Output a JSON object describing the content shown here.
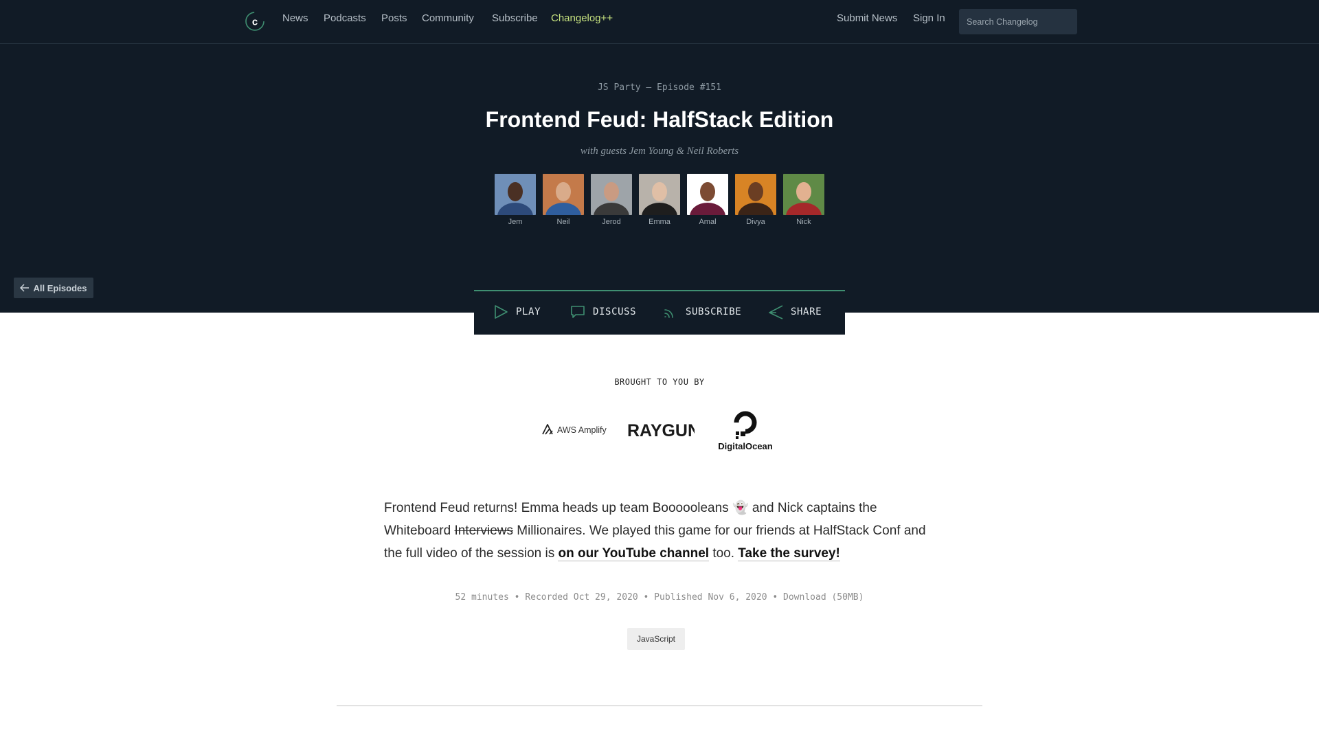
{
  "nav": {
    "links": [
      "News",
      "Podcasts",
      "Posts",
      "Community",
      "Subscribe",
      "Changelog++"
    ],
    "right_links": [
      "Submit News",
      "Sign In"
    ],
    "search_placeholder": "Search Changelog"
  },
  "episode": {
    "kicker": "JS Party – Episode #151",
    "title": "Frontend Feud: HalfStack Edition",
    "guests_line": "with guests Jem Young & Neil Roberts"
  },
  "people": [
    {
      "name": "Jem",
      "bg": "#6f8fb8",
      "skin": "#4a3024",
      "shirt": "#2d4a7a"
    },
    {
      "name": "Neil",
      "bg": "#c47a4a",
      "skin": "#d9ab8a",
      "shirt": "#2f5e9e"
    },
    {
      "name": "Jerod",
      "bg": "#9ea4a9",
      "skin": "#c99b82",
      "shirt": "#3a3a3a"
    },
    {
      "name": "Emma",
      "bg": "#b8b2aa",
      "skin": "#e0bfa6",
      "shirt": "#1e1e1e"
    },
    {
      "name": "Amal",
      "bg": "#ffffff",
      "skin": "#7c4b33",
      "shirt": "#6a1b3a"
    },
    {
      "name": "Divya",
      "bg": "#d88425",
      "skin": "#6b3e23",
      "shirt": "#3b2417"
    },
    {
      "name": "Nick",
      "bg": "#5f8a46",
      "skin": "#e2b190",
      "shirt": "#a5282a"
    }
  ],
  "back_button": "All Episodes",
  "actions": [
    "PLAY",
    "DISCUSS",
    "SUBSCRIBE",
    "SHARE"
  ],
  "brought_label": "BROUGHT TO YOU BY",
  "sponsors": [
    "AWS Amplify",
    "RAYGUN",
    "DigitalOcean"
  ],
  "description": {
    "part1": "Frontend Feud returns! Emma heads up team Boooooleans 👻 and Nick captains the Whiteboard ",
    "strike": "Interviews",
    "part2": " Millionaires. We played this game for our friends at HalfStack Conf and the full video of the session is ",
    "link1": "on our YouTube channel",
    "part3": " too. ",
    "link2": "Take the survey!"
  },
  "meta": {
    "duration": "52 minutes",
    "recorded": "Recorded Oct 29, 2020",
    "published": "Published Nov 6, 2020",
    "download": "Download (50MB)",
    "sep": "•"
  },
  "tag": "JavaScript",
  "colors": {
    "hero_bg": "#111b26",
    "accent_green": "#3f8f71",
    "plus_yellow": "#c6e27f"
  }
}
